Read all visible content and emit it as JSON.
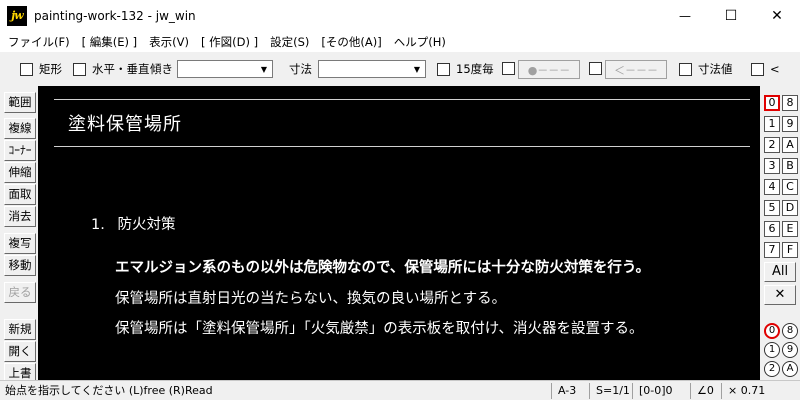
{
  "window": {
    "title": "painting-work-132 - jw_win",
    "app_icon_text": "jw",
    "controls": {
      "minimize": "—",
      "maximize": "☐",
      "close": "✕"
    }
  },
  "menu": [
    "ファイル(F)",
    "[ 編集(E) ]",
    "表示(V)",
    "[ 作図(D) ]",
    "設定(S)",
    "[その他(A)]",
    "ヘルプ(H)"
  ],
  "toolbar": {
    "rect_label": "矩形",
    "hv_label": "水平・垂直",
    "tilt_label": "傾き",
    "tilt_value": "",
    "dim_label": "寸法",
    "dim_value": "",
    "deg15_label": "15度毎",
    "dot_btn": "●－－－",
    "arrow_btn": "＜－－－",
    "dimval_label": "寸法値",
    "last_label": "<"
  },
  "left_tools": [
    "範囲",
    "複線",
    "ｺｰﾅｰ",
    "伸縮",
    "面取",
    "消去",
    "複写",
    "移動",
    "戻る",
    "新規",
    "開く",
    "上書"
  ],
  "drawing": {
    "title": "塗料保管場所",
    "section_number": "1.",
    "section_title": "防火対策",
    "lines": [
      "エマルジョン系のもの以外は危険物なので、保管場所には十分な防火対策を行う。",
      "保管場所は直射日光の当たらない、換気の良い場所とする。",
      "保管場所は「塗料保管場所」「火気厳禁」の表示板を取付け、消火器を設置する。"
    ]
  },
  "layers": {
    "left": [
      "0",
      "1",
      "2",
      "3",
      "4",
      "5",
      "6",
      "7"
    ],
    "right": [
      "8",
      "9",
      "A",
      "B",
      "C",
      "D",
      "E",
      "F"
    ],
    "all_label": "All",
    "x_label": "✕",
    "groups_left": [
      "0",
      "1",
      "2"
    ],
    "groups_right": [
      "8",
      "9",
      "A"
    ]
  },
  "status": {
    "message": "始点を指示してください (L)free (R)Read",
    "paper": "A-3",
    "scale": "S=1/1",
    "layer": "[0-0]0",
    "angle": "∠0",
    "factor": "× 0.71"
  }
}
